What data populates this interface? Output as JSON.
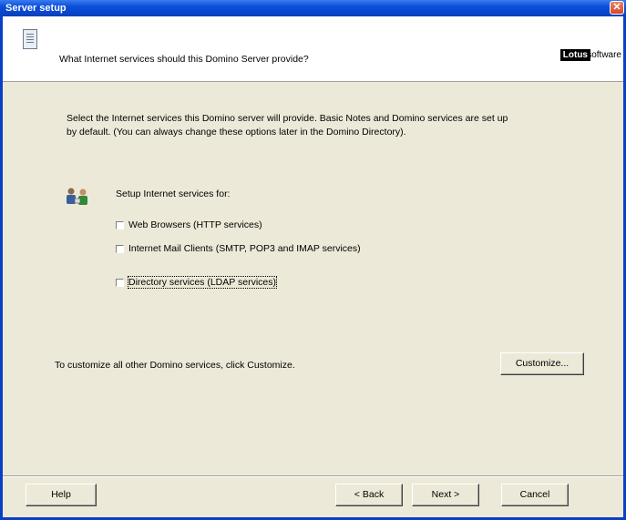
{
  "window": {
    "title": "Server setup"
  },
  "header": {
    "question": "What Internet services should this Domino Server provide?",
    "brand_badge": "Lotus",
    "brand_text": "software"
  },
  "intro": {
    "line1": "Select the Internet services this Domino server will provide. Basic Notes and Domino services are set up",
    "line2": "by default. (You can always change these options later in the Domino Directory)."
  },
  "services": {
    "label": "Setup Internet services for:",
    "options": [
      {
        "label": "Web Browsers (HTTP services)",
        "checked": false
      },
      {
        "label": "Internet Mail Clients (SMTP, POP3 and IMAP services)",
        "checked": false
      },
      {
        "label": "Directory services (LDAP services)",
        "checked": false
      }
    ]
  },
  "customize": {
    "text": "To customize all other Domino services, click Customize.",
    "button_label": "Customize..."
  },
  "footer": {
    "help": "Help",
    "back": "< Back",
    "next": "Next >",
    "cancel": "Cancel"
  },
  "colors": {
    "titlebar": "#0a4fd8",
    "dialog_bg": "#ece9d8"
  }
}
